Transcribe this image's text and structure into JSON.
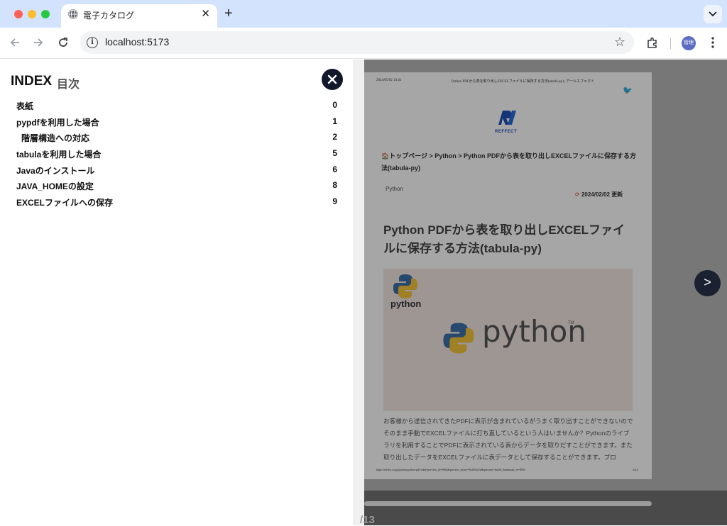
{
  "browser": {
    "tab_title": "電子カタログ",
    "tab_close": "✕",
    "new_tab": "+",
    "url": "localhost:5173",
    "profile_label": "管理"
  },
  "index": {
    "title": "INDEX",
    "subtitle": "目次",
    "items": [
      {
        "label": "表紙",
        "page": "0",
        "indent": false
      },
      {
        "label": "pypdfを利用した場合",
        "page": "1",
        "indent": false
      },
      {
        "label": "階層構造への対応",
        "page": "2",
        "indent": true
      },
      {
        "label": "tabulaを利用した場合",
        "page": "5",
        "indent": false
      },
      {
        "label": "Javaのインストール",
        "page": "6",
        "indent": false
      },
      {
        "label": "JAVA_HOMEの設定",
        "page": "8",
        "indent": false
      },
      {
        "label": "EXCELファイルへの保存",
        "page": "9",
        "indent": false
      }
    ]
  },
  "viewer": {
    "next_label": ">",
    "page_counter": "/13",
    "page": {
      "date": "2024/05/02 14:41",
      "header": "Python PDFから表を取り出しEXCELファイルに保存する方法(tabula-py) | アールエフェクト",
      "logo_text": "REFFECT",
      "breadcrumb": "トップページ > Python > Python PDFから表を取り出しEXCELファイルに保存する方法(tabula-py)",
      "category": "Python",
      "updated": "2024/02/02 更新",
      "title": "Python PDFから表を取り出しEXCELファイルに保存する方法(tabula-py)",
      "hero_small_text": "python",
      "hero_big_text": "python",
      "hero_tm": "TM",
      "body": "お客様から送信されてきたPDFに表示が含まれているがうまく取り出すことができないのでそのまま手動でEXCELファイルに打ち直しているという人はいませんか？Pythonのライブラリを利用することでPDFに表示されている表からデータを取りだすことができます。また取り出したデータをEXCELファイルに表データとして保存することができます。プロ",
      "footer_url": "https://reffect.co.jp/python/python-pdf-table?preview_id=8965&preview_nonce=9e2f9fa13d&preview=true&_thumbnail_id=8983",
      "footer_page": "1/14"
    }
  }
}
